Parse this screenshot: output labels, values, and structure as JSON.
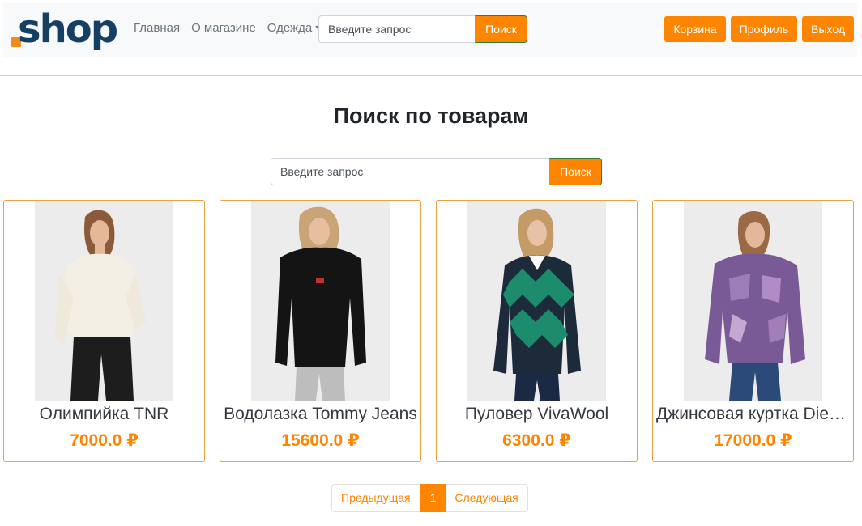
{
  "brand": {
    "logo_text": "shop",
    "accent_color": "#fd8500",
    "logo_color": "#153f63"
  },
  "nav": {
    "links": [
      "Главная",
      "О магазине",
      "Одежда"
    ],
    "search_placeholder": "Введите запрос",
    "search_button": "Поиск",
    "actions": [
      "Корзина",
      "Профиль",
      "Выход"
    ]
  },
  "main": {
    "title": "Поиск по товарам",
    "search_placeholder": "Введите запрос",
    "search_button": "Поиск"
  },
  "products": [
    {
      "name": "Олимпийка TNR",
      "price": "7000.0 ₽",
      "image": "model-cream-zip-sweater"
    },
    {
      "name": "Водолазка Tommy Jeans",
      "price": "15600.0 ₽",
      "image": "model-black-turtleneck"
    },
    {
      "name": "Пуловер VivaWool",
      "price": "6300.0 ₽",
      "image": "model-argyle-pullover"
    },
    {
      "name": "Джинсовая куртка Diesel",
      "price": "17000.0 ₽",
      "image": "model-purple-denim-jacket"
    }
  ],
  "pagination": {
    "prev": "Предыдущая",
    "current": "1",
    "next": "Следующая"
  }
}
